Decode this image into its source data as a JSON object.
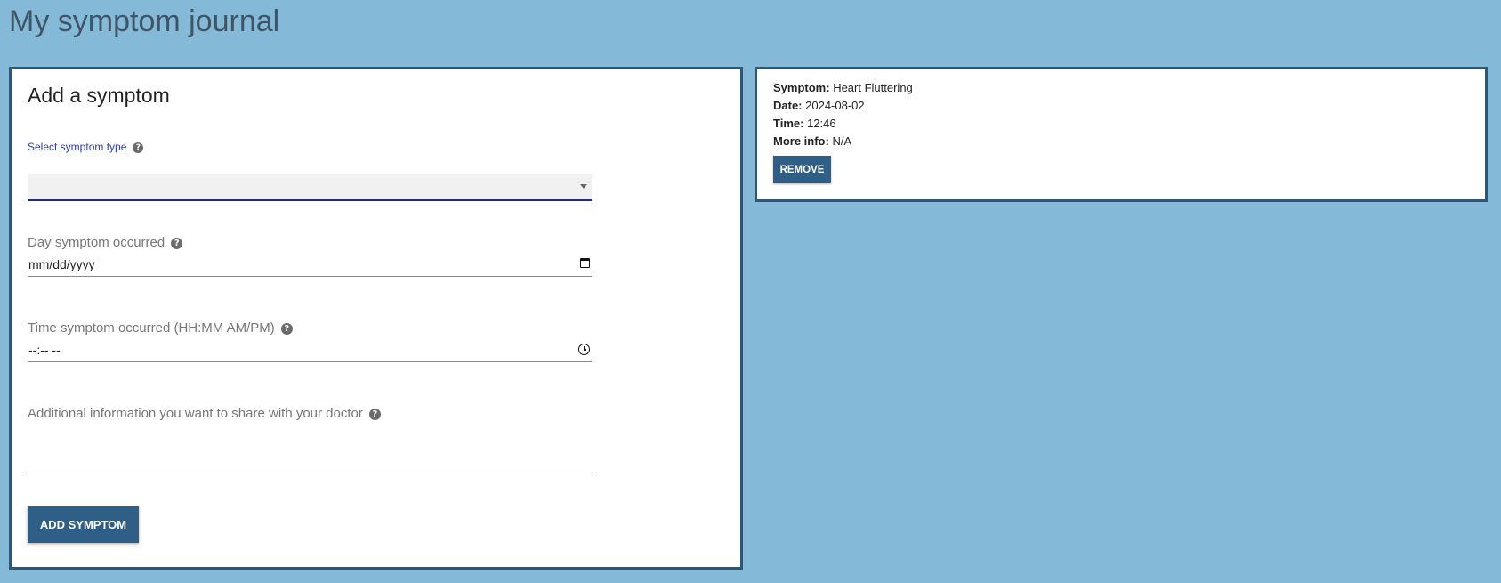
{
  "page": {
    "title": "My symptom journal"
  },
  "form": {
    "heading": "Add a symptom",
    "symptom_type": {
      "label": "Select symptom type",
      "value": ""
    },
    "date": {
      "label": "Day symptom occurred",
      "placeholder": "mm/dd/yyyy"
    },
    "time": {
      "label": "Time symptom occurred (HH:MM AM/PM)",
      "placeholder": "--:-- --"
    },
    "info": {
      "label": "Additional information you want to share with your doctor",
      "value": ""
    },
    "submit_label": "ADD SYMPTOM",
    "help_glyph": "?"
  },
  "entries": [
    {
      "symptom_label": "Symptom:",
      "symptom": "Heart Fluttering",
      "date_label": "Date:",
      "date": "2024-08-02",
      "time_label": "Time:",
      "time": "12:46",
      "info_label": "More info:",
      "info": "N/A",
      "remove_label": "REMOVE"
    }
  ],
  "colors": {
    "background": "#85b9d8",
    "panel_border": "#2d5677",
    "button": "#2f5f86",
    "select_label": "#2d3fa8",
    "select_underline": "#1d2a8f"
  },
  "icons": {
    "help": "help-circle-icon",
    "select_arrow": "dropdown-arrow-icon",
    "date": "calendar-icon",
    "time": "clock-icon"
  }
}
